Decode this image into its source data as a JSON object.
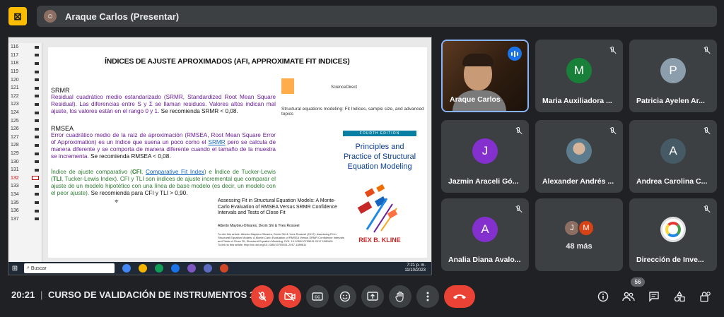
{
  "topbar": {
    "presenter_name": "Araque Carlos (Presentar)"
  },
  "slide": {
    "title": "ÍNDICES DE AJUSTE APROXIMADOS (AFI, APPROXIMATE FIT INDICES)",
    "srmr_heading": "SRMR",
    "srmr_text_purple": "Residual cuadrático medio estandarizado (SRMR, Standardized Root Mean Square Residual). Las diferencias entre S y Σ se llaman residuos. Valores altos indican mal ajuste, los valores están en el rango 0 y 1.",
    "srmr_text_black": "Se recomienda SRMR < 0,08.",
    "rmsea_heading": "RMSEA",
    "rmsea_text_purple_1": "Error cuadrático medio de la raíz de aproximación (RMSEA, Root Mean Square Error of Approximation) es un índice que suena un poco como el",
    "rmsea_link": "SRMR",
    "rmsea_text_purple_2": "pero se calcula de manera diferente y se comporta de manera diferente cuando el tamaño de la muestra se incrementa.",
    "rmsea_text_black": "Se recomienda RMSEA < 0,08.",
    "cfi_text_green_1": "Índice de ajuste comparativo (",
    "cfi_bold": "CFI",
    "cfi_text_green_2": ",",
    "cfi_link": "Comparative Fit Index",
    "cfi_text_green_3": ") e Índice de Tucker-Lewis (",
    "tli_bold": "TLI",
    "cfi_text_green_4": ", Tucker-Lewis Index).",
    "cfi_text_green_5": "CFI y TLI son índices de ajuste incremental que comparar el ajuste de un modelo hipotético con una línea de base modelo (es decir, un modelo con el peor ajuste).",
    "cfi_text_black": "Se recomienda para CFI y TLI > 0,90.",
    "paper_sd": "ScienceDirect",
    "paper_title": "Structural equations modeling: Fit Indices, sample size, and advanced topics",
    "book_edition": "FOURTH EDITION",
    "book_title": "Principles and Practice of Structural Equation Modeling",
    "book_author": "REX B. KLINE",
    "article_title": "Assessing Fit in Structural Equation Models: A Monte-Carlo Evaluation of RMSEA Versus SRMR Confidence Intervals and Tests of Close Fit",
    "article_authors": "Alberto Maydeu-Olivares, Dexin Shi & Yves Rosseel",
    "article_cite": "To cite this article: Alberto Maydeu-Olivares, Dexin Shi & Yves Rosseel (2017): Assessing Fit in Structural Equation Models: A Monte-Carlo Evaluation of RMSEA Versus SRMR Confidence Intervals and Tests of Close Fit, Structural Equation Modeling. DOI: 10.1080/10705511.2017.1389611",
    "article_link": "To link to this article: http://dx.doi.org/10.1080/10705511.2017.1389611"
  },
  "thumbnails": [
    "116",
    "117",
    "118",
    "119",
    "120",
    "121",
    "122",
    "123",
    "124",
    "125",
    "126",
    "127",
    "128",
    "129",
    "130",
    "131",
    "132",
    "133",
    "134",
    "135",
    "136",
    "137"
  ],
  "active_thumbnail": "132",
  "taskbar": {
    "search_placeholder": "Buscar",
    "time": "7:21 p. m.",
    "date": "11/10/2023"
  },
  "participants": [
    {
      "name": "Araque Carlos",
      "initial": "",
      "color": "",
      "type": "video",
      "speaking": true
    },
    {
      "name": "Maria Auxiliadora ...",
      "initial": "M",
      "color": "#188038",
      "type": "initial"
    },
    {
      "name": "Patricia Ayelen Ar...",
      "initial": "P",
      "color": "#8c9eab",
      "type": "initial"
    },
    {
      "name": "Jazmin Araceli Gó...",
      "initial": "J",
      "color": "#8430ce",
      "type": "initial"
    },
    {
      "name": "Alexander Andrés ...",
      "initial": "",
      "color": "",
      "type": "photo"
    },
    {
      "name": "Andrea Carolina C...",
      "initial": "A",
      "color": "#455a64",
      "type": "initial"
    },
    {
      "name": "Analia Diana Avalo...",
      "initial": "A",
      "color": "#8430ce",
      "type": "initial"
    },
    {
      "name": "",
      "initial": "",
      "color": "",
      "type": "more"
    },
    {
      "name": "Dirección de Inve...",
      "initial": "",
      "color": "",
      "type": "logo"
    }
  ],
  "more_tile": {
    "label": "48 más",
    "initial_1": "J",
    "color_1": "#8d6e63",
    "initial_2": "M",
    "color_2": "#d84315"
  },
  "bottombar": {
    "time": "20:21",
    "separator": "|",
    "meeting_title": "CURSO DE VALIDACIÓN DE INSTRUMENTOS 1...",
    "participant_count": "56"
  },
  "icons": {
    "mic": "mic-off-icon",
    "camera": "camera-off-icon",
    "captions": "captions-icon",
    "emoji": "emoji-icon",
    "present": "present-icon",
    "hand": "raise-hand-icon",
    "more": "more-options-icon",
    "hangup": "hangup-icon",
    "info": "info-icon",
    "people": "people-icon",
    "chat": "chat-icon",
    "activities": "activities-icon",
    "host": "host-controls-icon"
  },
  "colors": {
    "accent_red": "#ea4335",
    "speaking_blue": "#1a73e8",
    "present_yellow": "#fbbc04"
  }
}
